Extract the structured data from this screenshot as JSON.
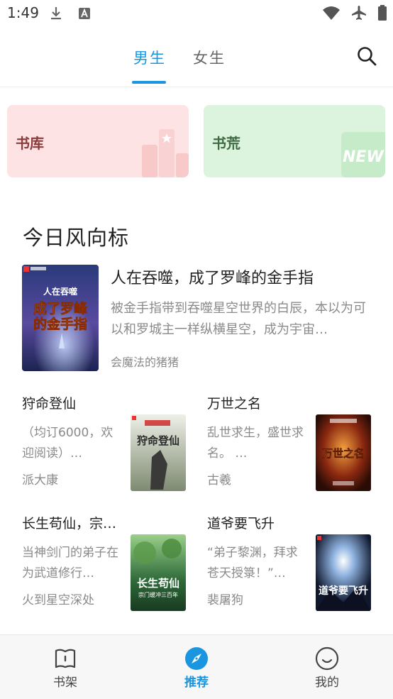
{
  "status_bar": {
    "time": "1:49",
    "left_icons": [
      "download-icon",
      "a-icon"
    ],
    "right_icons": [
      "wifi-icon",
      "airplane-icon",
      "battery-icon"
    ]
  },
  "top_tabs": {
    "tabs": [
      {
        "label": "男生",
        "active": true
      },
      {
        "label": "女生",
        "active": false
      }
    ],
    "search_icon": "search-icon",
    "accent_color": "#1a96e0"
  },
  "cards": [
    {
      "label": "书库",
      "color": "#fde3e3",
      "decoration": "bar-chart-star"
    },
    {
      "label": "书荒",
      "color": "#dcf3dd",
      "decoration": "NEW"
    }
  ],
  "section": {
    "title": "今日风向标",
    "featured": {
      "title": "人在吞噬，成了罗峰的金手指",
      "description": "被金手指带到吞噬星空世界的白辰，本以为可以和罗城主一样纵横星空，成为宇宙…",
      "author": "会魔法的猪猪",
      "cover_text": [
        "人在吞噬",
        "成了罗峰",
        "的金手指"
      ]
    },
    "books": [
      {
        "title": "狩命登仙",
        "description": "（均订6000，欢迎阅读）…",
        "author": "派大康",
        "cover_text": "狩命登仙"
      },
      {
        "title": "万世之名",
        "description": "乱世求生，盛世求名。 …",
        "author": "古羲",
        "cover_text": "万世之名"
      },
      {
        "title": "长生苟仙，宗…",
        "description": "当神剑门的弟子在为武道修行…",
        "author": "火到星空深处",
        "cover_text": [
          "长生苟仙",
          "宗门缓冲三百年"
        ]
      },
      {
        "title": "道爷要飞升",
        "description": "“弟子黎渊，拜求苍天授箓！”…",
        "author": "裴屠狗",
        "cover_text": "道爷要飞升"
      }
    ]
  },
  "bottom_nav": {
    "items": [
      {
        "label": "书架",
        "icon": "bookshelf-icon",
        "active": false
      },
      {
        "label": "推荐",
        "icon": "compass-icon",
        "active": true
      },
      {
        "label": "我的",
        "icon": "smiley-icon",
        "active": false
      }
    ]
  }
}
